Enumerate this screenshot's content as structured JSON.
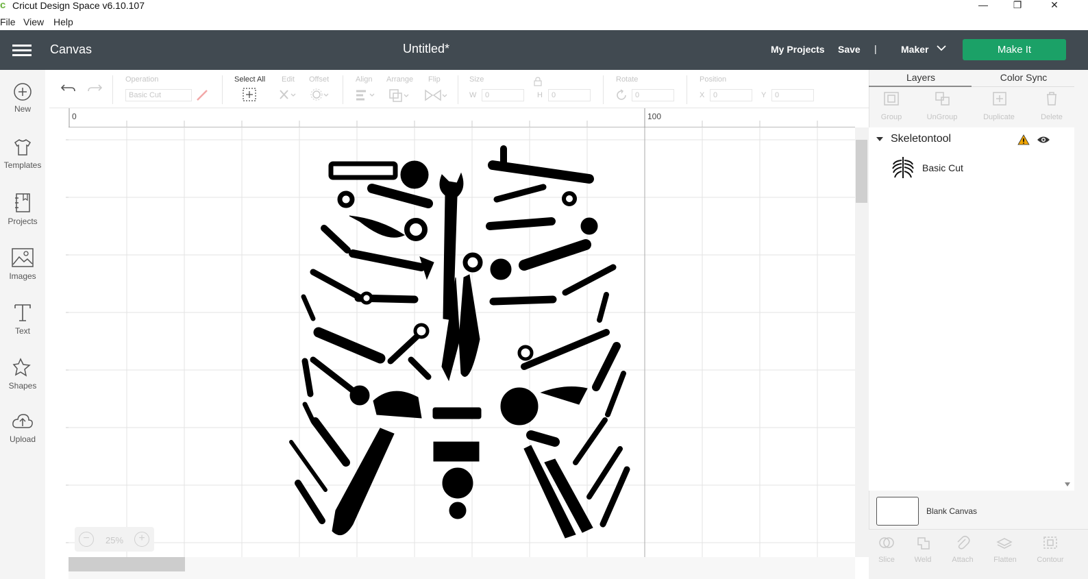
{
  "window": {
    "title": "Cricut Design Space  v6.10.107",
    "minimize_glyph": "—",
    "restore_glyph": "❐",
    "close_glyph": "✕"
  },
  "menu": [
    "File",
    "View",
    "Help"
  ],
  "header": {
    "section": "Canvas",
    "document_title": "Untitled*",
    "my_projects": "My Projects",
    "save": "Save",
    "separator": "|",
    "machine": "Maker",
    "make_it": "Make It"
  },
  "sidebar": [
    {
      "label": "New",
      "icon": "plus-circle-icon"
    },
    {
      "label": "Templates",
      "icon": "tshirt-icon"
    },
    {
      "label": "Projects",
      "icon": "notebook-icon"
    },
    {
      "label": "Images",
      "icon": "image-icon"
    },
    {
      "label": "Text",
      "icon": "text-icon"
    },
    {
      "label": "Shapes",
      "icon": "shapes-icon"
    },
    {
      "label": "Upload",
      "icon": "upload-cloud-icon"
    }
  ],
  "toolbar": {
    "operation_label": "Operation",
    "operation_value": "Basic Cut",
    "select_all": "Select All",
    "edit": "Edit",
    "offset": "Offset",
    "align": "Align",
    "arrange": "Arrange",
    "flip": "Flip",
    "size": "Size",
    "w": "W",
    "h": "H",
    "w_value": "0",
    "h_value": "0",
    "rotate": "Rotate",
    "rotate_value": "0",
    "position": "Position",
    "x": "X",
    "y": "Y",
    "x_value": "0",
    "y_value": "0"
  },
  "canvas": {
    "ruler_marks": [
      "0",
      "100"
    ],
    "zoom": "25%",
    "zoom_minus": "−",
    "zoom_plus": "+"
  },
  "right_panel": {
    "tabs": [
      "Layers",
      "Color Sync"
    ],
    "actions": [
      "Group",
      "UnGroup",
      "Duplicate",
      "Delete"
    ],
    "layer_group": "Skeletontool",
    "layer_item": "Basic Cut",
    "blank_canvas": "Blank Canvas",
    "bottom_actions": [
      "Slice",
      "Weld",
      "Attach",
      "Flatten",
      "Contour"
    ]
  },
  "colors": {
    "header_bg": "#414a51",
    "make_it": "#1ba167",
    "warning": "#f0a500",
    "logo": "#6cb33f"
  }
}
